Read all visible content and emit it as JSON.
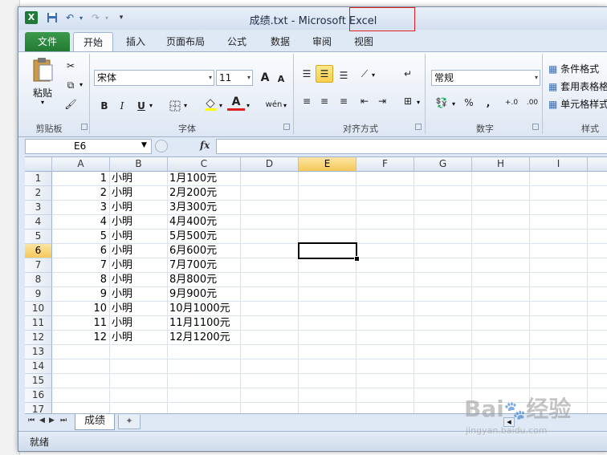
{
  "titlebar": {
    "filename": "成绩.txt",
    "separator": "-",
    "app": "Microsoft Excel"
  },
  "ribbon_tabs": [
    "文件",
    "开始",
    "插入",
    "页面布局",
    "公式",
    "数据",
    "审阅",
    "视图"
  ],
  "clipboard": {
    "paste": "粘贴",
    "label": "剪贴板"
  },
  "font": {
    "name": "宋体",
    "size": "11",
    "label": "字体",
    "bold": "B",
    "italic": "I",
    "underline": "U",
    "grow": "A",
    "shrink": "A",
    "color_glyph": "A",
    "wen_glyph": "wén"
  },
  "alignment": {
    "label": "对齐方式"
  },
  "number": {
    "format": "常规",
    "label": "数字",
    "percent": "%",
    "comma": ",",
    "inc": "+.0",
    "dec": ".00"
  },
  "styles": {
    "cond_format": "条件格式",
    "table_format": "套用表格格",
    "cell_style": "单元格样式",
    "label": "样式"
  },
  "formula_bar": {
    "name_box": "E6",
    "fx": "fx",
    "content": ""
  },
  "columns": [
    "A",
    "B",
    "C",
    "D",
    "E",
    "F",
    "G",
    "H",
    "I"
  ],
  "rows": [
    "1",
    "2",
    "3",
    "4",
    "5",
    "6",
    "7",
    "8",
    "9",
    "10",
    "11",
    "12",
    "13",
    "14",
    "15",
    "16",
    "17"
  ],
  "selected_cell": {
    "column": "E",
    "row": "6"
  },
  "data_rows": [
    {
      "a": "1",
      "b": "小明",
      "c": "1月100元"
    },
    {
      "a": "2",
      "b": "小明",
      "c": "2月200元"
    },
    {
      "a": "3",
      "b": "小明",
      "c": "3月300元"
    },
    {
      "a": "4",
      "b": "小明",
      "c": "4月400元"
    },
    {
      "a": "5",
      "b": "小明",
      "c": "5月500元"
    },
    {
      "a": "6",
      "b": "小明",
      "c": "6月600元"
    },
    {
      "a": "7",
      "b": "小明",
      "c": "7月700元"
    },
    {
      "a": "8",
      "b": "小明",
      "c": "8月800元"
    },
    {
      "a": "9",
      "b": "小明",
      "c": "9月900元"
    },
    {
      "a": "10",
      "b": "小明",
      "c": "10月1000元"
    },
    {
      "a": "11",
      "b": "小明",
      "c": "11月1100元"
    },
    {
      "a": "12",
      "b": "小明",
      "c": "12月1200元"
    }
  ],
  "sheet_tabs": [
    "成绩"
  ],
  "status": {
    "text": "就绪"
  },
  "watermark": {
    "brand": "Baidu经验",
    "url": "jingyan.baidu.com"
  },
  "colors": {
    "file_tab": "#2a8a3c",
    "selected_header": "#f6c95b",
    "ribbon_bg": "#dfe9f5"
  }
}
